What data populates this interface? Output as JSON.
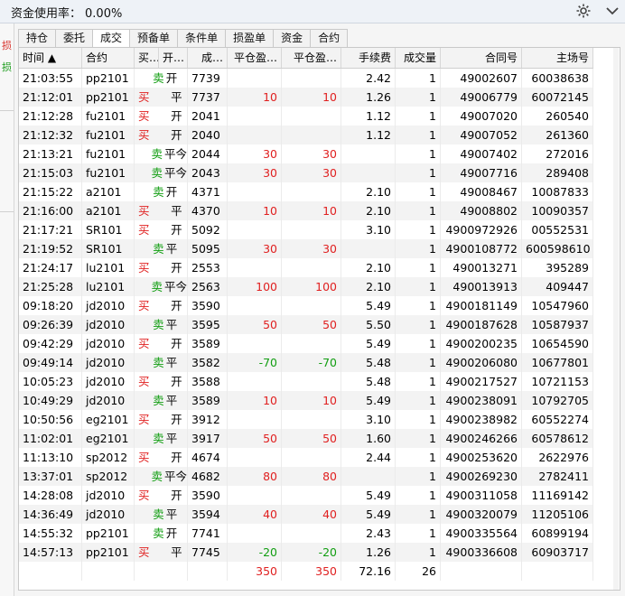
{
  "topbar": {
    "label": "资金使用率：",
    "value": "0.00%"
  },
  "sidebar": {
    "mark1": "损",
    "mark2": "损"
  },
  "tabs": [
    "持仓",
    "委托",
    "成交",
    "预备单",
    "条件单",
    "损盈单",
    "资金",
    "合约"
  ],
  "active_tab": 2,
  "columns": [
    "时间 ▲",
    "合约",
    "买…",
    "开…",
    "成…",
    "平仓盈…",
    "平仓盈…",
    "手续费",
    "成交量",
    "合同号",
    "主场号"
  ],
  "rows": [
    {
      "time": "21:03:55",
      "contract": "pp2101",
      "bs": "卖",
      "oc": "开",
      "price": "7739",
      "pnl1": "",
      "pnl2": "",
      "fee": "2.42",
      "qty": "1",
      "order": "49002607",
      "exch": "60038638"
    },
    {
      "time": "21:12:01",
      "contract": "pp2101",
      "bs": "买",
      "oc": "平",
      "price": "7737",
      "pnl1": "10",
      "pnl2": "10",
      "fee": "1.26",
      "qty": "1",
      "order": "49006779",
      "exch": "60072145"
    },
    {
      "time": "21:12:28",
      "contract": "fu2101",
      "bs": "买",
      "oc": "开",
      "price": "2041",
      "pnl1": "",
      "pnl2": "",
      "fee": "1.12",
      "qty": "1",
      "order": "49007020",
      "exch": "260540"
    },
    {
      "time": "21:12:32",
      "contract": "fu2101",
      "bs": "买",
      "oc": "开",
      "price": "2040",
      "pnl1": "",
      "pnl2": "",
      "fee": "1.12",
      "qty": "1",
      "order": "49007052",
      "exch": "261360"
    },
    {
      "time": "21:13:21",
      "contract": "fu2101",
      "bs": "卖",
      "oc": "平今",
      "price": "2044",
      "pnl1": "30",
      "pnl2": "30",
      "fee": "",
      "qty": "1",
      "order": "49007402",
      "exch": "272016"
    },
    {
      "time": "21:15:03",
      "contract": "fu2101",
      "bs": "卖",
      "oc": "平今",
      "price": "2043",
      "pnl1": "30",
      "pnl2": "30",
      "fee": "",
      "qty": "1",
      "order": "49007716",
      "exch": "289408"
    },
    {
      "time": "21:15:22",
      "contract": "a2101",
      "bs": "卖",
      "oc": "开",
      "price": "4371",
      "pnl1": "",
      "pnl2": "",
      "fee": "2.10",
      "qty": "1",
      "order": "49008467",
      "exch": "10087833"
    },
    {
      "time": "21:16:00",
      "contract": "a2101",
      "bs": "买",
      "oc": "平",
      "price": "4370",
      "pnl1": "10",
      "pnl2": "10",
      "fee": "2.10",
      "qty": "1",
      "order": "49008802",
      "exch": "10090357"
    },
    {
      "time": "21:17:21",
      "contract": "SR101",
      "bs": "买",
      "oc": "开",
      "price": "5092",
      "pnl1": "",
      "pnl2": "",
      "fee": "3.10",
      "qty": "1",
      "order": "4900972926",
      "exch": "00552531"
    },
    {
      "time": "21:19:52",
      "contract": "SR101",
      "bs": "卖",
      "oc": "平",
      "price": "5095",
      "pnl1": "30",
      "pnl2": "30",
      "fee": "",
      "qty": "1",
      "order": "4900108772",
      "exch": "600598610"
    },
    {
      "time": "21:24:17",
      "contract": "lu2101",
      "bs": "买",
      "oc": "开",
      "price": "2553",
      "pnl1": "",
      "pnl2": "",
      "fee": "2.10",
      "qty": "1",
      "order": "490013271",
      "exch": "395289"
    },
    {
      "time": "21:25:28",
      "contract": "lu2101",
      "bs": "卖",
      "oc": "平今",
      "price": "2563",
      "pnl1": "100",
      "pnl2": "100",
      "fee": "2.10",
      "qty": "1",
      "order": "490013913",
      "exch": "409447"
    },
    {
      "time": "09:18:20",
      "contract": "jd2010",
      "bs": "买",
      "oc": "开",
      "price": "3590",
      "pnl1": "",
      "pnl2": "",
      "fee": "5.49",
      "qty": "1",
      "order": "4900181149",
      "exch": "10547960"
    },
    {
      "time": "09:26:39",
      "contract": "jd2010",
      "bs": "卖",
      "oc": "平",
      "price": "3595",
      "pnl1": "50",
      "pnl2": "50",
      "fee": "5.50",
      "qty": "1",
      "order": "4900187628",
      "exch": "10587937"
    },
    {
      "time": "09:42:29",
      "contract": "jd2010",
      "bs": "买",
      "oc": "开",
      "price": "3589",
      "pnl1": "",
      "pnl2": "",
      "fee": "5.49",
      "qty": "1",
      "order": "4900200235",
      "exch": "10654590"
    },
    {
      "time": "09:49:14",
      "contract": "jd2010",
      "bs": "卖",
      "oc": "平",
      "price": "3582",
      "pnl1": "-70",
      "pnl2": "-70",
      "fee": "5.48",
      "qty": "1",
      "order": "4900206080",
      "exch": "10677801"
    },
    {
      "time": "10:05:23",
      "contract": "jd2010",
      "bs": "买",
      "oc": "开",
      "price": "3588",
      "pnl1": "",
      "pnl2": "",
      "fee": "5.48",
      "qty": "1",
      "order": "4900217527",
      "exch": "10721153"
    },
    {
      "time": "10:49:29",
      "contract": "jd2010",
      "bs": "卖",
      "oc": "平",
      "price": "3589",
      "pnl1": "10",
      "pnl2": "10",
      "fee": "5.49",
      "qty": "1",
      "order": "4900238091",
      "exch": "10792705"
    },
    {
      "time": "10:50:56",
      "contract": "eg2101",
      "bs": "买",
      "oc": "开",
      "price": "3912",
      "pnl1": "",
      "pnl2": "",
      "fee": "3.10",
      "qty": "1",
      "order": "4900238982",
      "exch": "60552274"
    },
    {
      "time": "11:02:01",
      "contract": "eg2101",
      "bs": "卖",
      "oc": "平",
      "price": "3917",
      "pnl1": "50",
      "pnl2": "50",
      "fee": "1.60",
      "qty": "1",
      "order": "4900246266",
      "exch": "60578612"
    },
    {
      "time": "11:13:10",
      "contract": "sp2012",
      "bs": "买",
      "oc": "开",
      "price": "4674",
      "pnl1": "",
      "pnl2": "",
      "fee": "2.44",
      "qty": "1",
      "order": "4900253620",
      "exch": "2622976"
    },
    {
      "time": "13:37:01",
      "contract": "sp2012",
      "bs": "卖",
      "oc": "平今",
      "price": "4682",
      "pnl1": "80",
      "pnl2": "80",
      "fee": "",
      "qty": "1",
      "order": "4900269230",
      "exch": "2782411"
    },
    {
      "time": "14:28:08",
      "contract": "jd2010",
      "bs": "买",
      "oc": "开",
      "price": "3590",
      "pnl1": "",
      "pnl2": "",
      "fee": "5.49",
      "qty": "1",
      "order": "4900311058",
      "exch": "11169142"
    },
    {
      "time": "14:36:49",
      "contract": "jd2010",
      "bs": "卖",
      "oc": "平",
      "price": "3594",
      "pnl1": "40",
      "pnl2": "40",
      "fee": "5.49",
      "qty": "1",
      "order": "4900320079",
      "exch": "11205106"
    },
    {
      "time": "14:55:32",
      "contract": "pp2101",
      "bs": "卖",
      "oc": "开",
      "price": "7741",
      "pnl1": "",
      "pnl2": "",
      "fee": "2.43",
      "qty": "1",
      "order": "4900335564",
      "exch": "60899194"
    },
    {
      "time": "14:57:13",
      "contract": "pp2101",
      "bs": "买",
      "oc": "平",
      "price": "7745",
      "pnl1": "-20",
      "pnl2": "-20",
      "fee": "1.26",
      "qty": "1",
      "order": "4900336608",
      "exch": "60903717"
    }
  ],
  "totals": {
    "pnl1": "350",
    "pnl2": "350",
    "fee": "72.16",
    "qty": "26"
  },
  "colors": {
    "buy": "#e02020",
    "sell": "#129e12"
  },
  "icons": {
    "settings": "gear-icon",
    "collapse": "chevron-down-icon"
  }
}
